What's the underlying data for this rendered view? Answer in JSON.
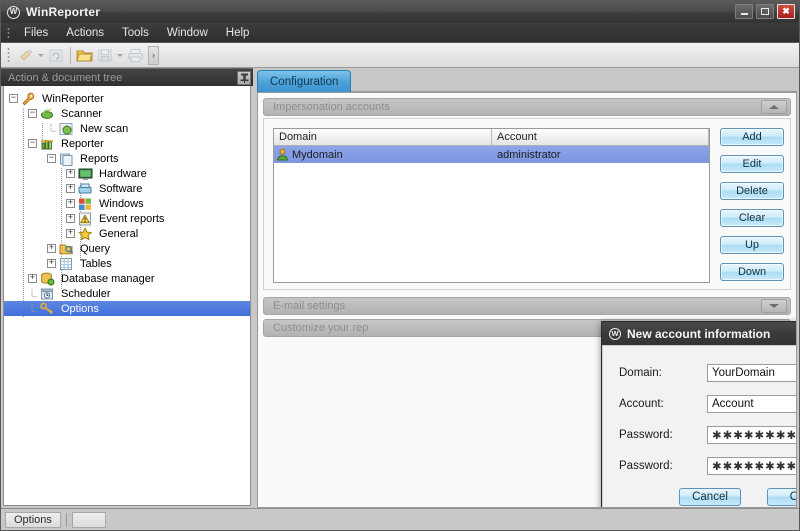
{
  "window": {
    "title": "WinReporter",
    "logo_text": "W",
    "logo_icon": "app-logo-icon",
    "minimize_label": "minimize-icon",
    "maximize_label": "maximize-icon",
    "close_label": "✖"
  },
  "menu": {
    "items": [
      {
        "label": "Files"
      },
      {
        "label": "Actions"
      },
      {
        "label": "Tools"
      },
      {
        "label": "Window"
      },
      {
        "label": "Help"
      }
    ]
  },
  "toolbar": {
    "icons": [
      "scan-icon",
      "refresh-icon",
      "open-folder-icon",
      "save-icon",
      "print-icon"
    ],
    "overflow_label": "›"
  },
  "tree_panel": {
    "header_title": "Action & document tree",
    "pin_icon": "pin-icon",
    "items": [
      {
        "label": "WinReporter",
        "depth": 0,
        "expander": "minus",
        "icon": "wrench-icon",
        "selected": false
      },
      {
        "label": "Scanner",
        "depth": 1,
        "expander": "minus",
        "icon": "scanner-icon",
        "selected": false
      },
      {
        "label": "New scan",
        "depth": 2,
        "expander": "none",
        "icon": "new-scan-icon",
        "selected": false
      },
      {
        "label": "Reporter",
        "depth": 1,
        "expander": "minus",
        "icon": "reporter-icon",
        "selected": false
      },
      {
        "label": "Reports",
        "depth": 2,
        "expander": "minus",
        "icon": "reports-icon",
        "selected": false
      },
      {
        "label": "Hardware",
        "depth": 3,
        "expander": "plus",
        "icon": "hardware-icon",
        "selected": false
      },
      {
        "label": "Software",
        "depth": 3,
        "expander": "plus",
        "icon": "software-icon",
        "selected": false
      },
      {
        "label": "Windows",
        "depth": 3,
        "expander": "plus",
        "icon": "windows-icon",
        "selected": false
      },
      {
        "label": "Event reports",
        "depth": 3,
        "expander": "plus",
        "icon": "event-icon",
        "selected": false
      },
      {
        "label": "General",
        "depth": 3,
        "expander": "plus",
        "icon": "star-icon",
        "selected": false
      },
      {
        "label": "Query",
        "depth": 2,
        "expander": "plus",
        "icon": "query-icon",
        "selected": false
      },
      {
        "label": "Tables",
        "depth": 2,
        "expander": "plus",
        "icon": "tables-icon",
        "selected": false
      },
      {
        "label": "Database manager",
        "depth": 1,
        "expander": "plus",
        "icon": "database-icon",
        "selected": false
      },
      {
        "label": "Scheduler",
        "depth": 1,
        "expander": "none",
        "icon": "scheduler-icon",
        "selected": false
      },
      {
        "label": "Options",
        "depth": 1,
        "expander": "none",
        "icon": "options-key-icon",
        "selected": true
      }
    ]
  },
  "content": {
    "tabs": [
      {
        "label": "Configuration",
        "active": true
      }
    ],
    "sections": [
      {
        "label": "Impersonation accounts",
        "state": "expanded",
        "toggle_icon": "chevron-up-icon"
      },
      {
        "label": "E-mail settings",
        "state": "collapsed",
        "toggle_icon": "chevron-down-icon"
      },
      {
        "label": "Customize your rep",
        "state": "collapsed",
        "toggle_icon": "chevron-down-icon"
      }
    ],
    "grid": {
      "columns": [
        "Domain",
        "Account"
      ],
      "rows": [
        {
          "icon": "user-account-icon",
          "domain": "Mydomain",
          "account": "administrator",
          "selected": true
        }
      ]
    },
    "buttons": [
      {
        "label": "Add"
      },
      {
        "label": "Edit"
      },
      {
        "label": "Delete"
      },
      {
        "label": "Clear"
      },
      {
        "label": "Up"
      },
      {
        "label": "Down"
      }
    ]
  },
  "dialog": {
    "title": "New account information",
    "logo_text": "W",
    "close_label": "✖",
    "fields": [
      {
        "label": "Domain:",
        "value": "YourDomain",
        "type": "text",
        "caret": false
      },
      {
        "label": "Account:",
        "value": "Account",
        "type": "text",
        "caret": false
      },
      {
        "label": "Password:",
        "value": "✱✱✱✱✱✱✱✱",
        "type": "password",
        "caret": false
      },
      {
        "label": "Password:",
        "value": "✱✱✱✱✱✱✱✱",
        "type": "password",
        "caret": true
      }
    ],
    "cancel_label": "Cancel",
    "ok_label": "OK"
  },
  "status_bar": {
    "text": "Options"
  },
  "colors": {
    "accent_blue": "#4ea3da",
    "selection_blue": "#7e96e0",
    "titlebar_dark": "#3c3c3c",
    "close_red": "#a81f1c",
    "button_blue": "#a9dcf4"
  }
}
